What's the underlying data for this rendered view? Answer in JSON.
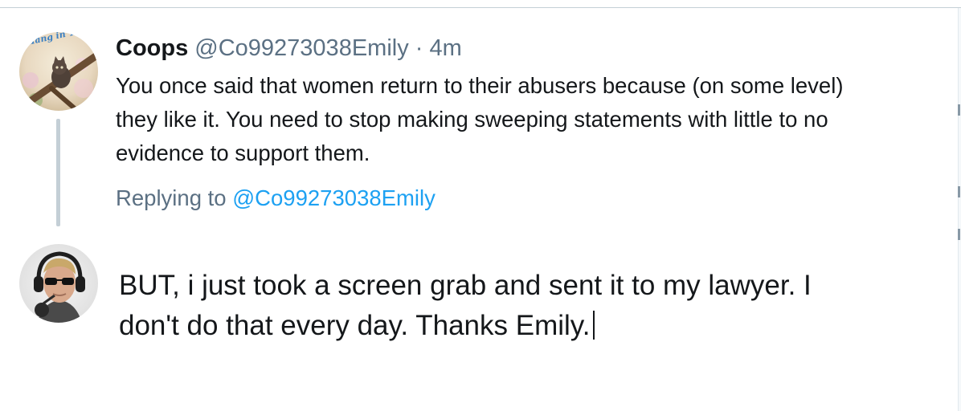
{
  "parent_tweet": {
    "display_name": "Coops",
    "handle": "@Co99273038Emily",
    "separator": "·",
    "time": "4m",
    "text": "You once said that women return to their abusers because (on some level)\nthey like it. You need to stop making sweeping statements with little to no\nevidence to support them.",
    "avatar_icon": "profile-photo-kitten-in-tree",
    "avatar_text": "Hang in There!"
  },
  "reply_context": {
    "prefix": "Replying to",
    "mention": "@Co99273038Emily"
  },
  "composer": {
    "text": "BUT, i just took a screen grab and sent it to my lawyer.  I\ndon't do that every day.  Thanks Emily.",
    "avatar_icon": "profile-photo-man-with-headphones"
  },
  "colors": {
    "primary_text": "#14171a",
    "secondary_text": "#5b7083",
    "link": "#1da1f2",
    "thread_line": "#c4cfd6"
  }
}
